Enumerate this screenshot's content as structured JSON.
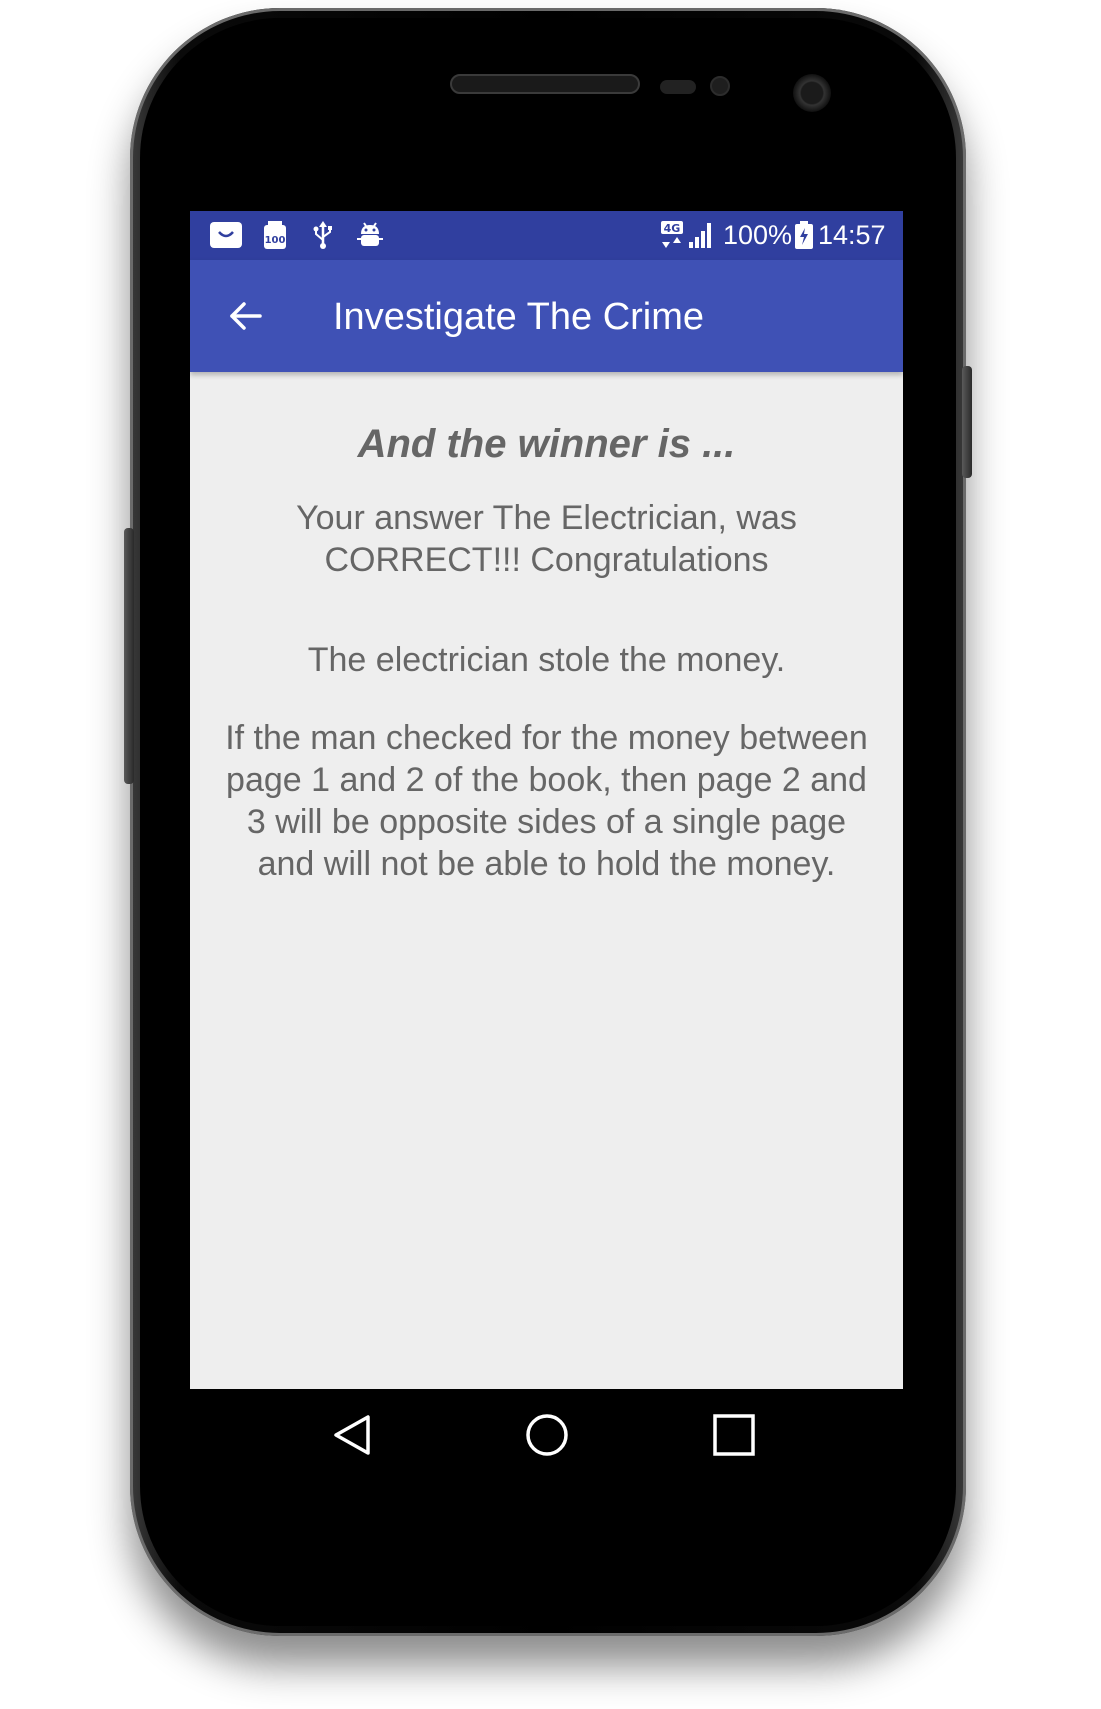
{
  "status_bar": {
    "icons": [
      "shopping-bag-icon",
      "battery-saver-100-icon",
      "usb-icon",
      "android-debug-icon",
      "4g-data-icon",
      "signal-icon",
      "battery-charging-icon"
    ],
    "network_label": "4G",
    "battery_percent": "100%",
    "time": "14:57"
  },
  "app_bar": {
    "back_icon": "arrow-back-icon",
    "title": "Investigate The Crime"
  },
  "result": {
    "heading": "And the winner is ...",
    "answer_text": "Your answer The Electrician, was CORRECT!!! Congratulations",
    "culprit_text": "The electrician stole the money.",
    "explanation_text": "If the man checked for the money between page 1 and 2 of the book, then page 2 and 3 will be opposite sides of a single page and will not be able to hold the money."
  },
  "nav_bar": {
    "icons": [
      "nav-back-icon",
      "nav-home-icon",
      "nav-recents-icon"
    ]
  },
  "colors": {
    "status_bar": "#303f9f",
    "app_bar": "#3f51b5",
    "background": "#eeeeee",
    "text": "#666666"
  }
}
